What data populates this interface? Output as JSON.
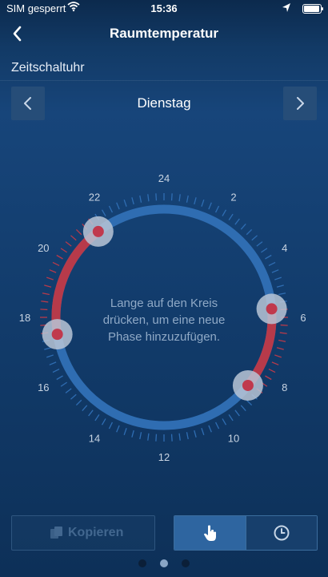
{
  "status_bar": {
    "carrier": "SIM gesperrt",
    "time": "15:36"
  },
  "navbar": {
    "title": "Raumtemperatur"
  },
  "section_title": "Zeitschaltuhr",
  "day_selector": {
    "day": "Dienstag"
  },
  "dial": {
    "hint_line1": "Lange auf den Kreis",
    "hint_line2": "drücken, um eine neue",
    "hint_line3": "Phase hinzuzufügen.",
    "hour_labels": [
      "24",
      "2",
      "4",
      "6",
      "8",
      "10",
      "12",
      "14",
      "16",
      "18",
      "20",
      "22"
    ],
    "phase_handles_hours": [
      21.5,
      5.7,
      8.6,
      17.4
    ],
    "heating_ranges_hours": [
      [
        17.4,
        21.5
      ],
      [
        5.7,
        8.6
      ]
    ],
    "colors": {
      "comfort": "#b73a4a",
      "eco": "#2f6db2",
      "handle_ring": "#b9c6d6",
      "handle_center": "#c0394d"
    }
  },
  "bottom_bar": {
    "copy_label": "Kopieren",
    "segment_left_icon": "hand-pointer-icon",
    "segment_right_icon": "clock-icon"
  },
  "pager": {
    "pages": 3,
    "active_index": 1
  }
}
